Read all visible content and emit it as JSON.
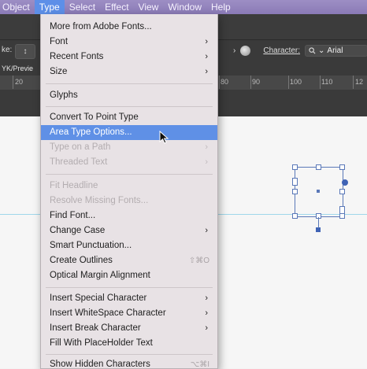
{
  "menubar": {
    "items": [
      "Object",
      "Type",
      "Select",
      "Effect",
      "View",
      "Window",
      "Help"
    ],
    "active": "Type"
  },
  "control_bar": {
    "stroke_label": "ke:",
    "stroke_stepper": "↕",
    "character_label": "Character:",
    "font_search_icon": "search-icon",
    "font_value": "Arial"
  },
  "document_tab": {
    "label": "YK/Previe"
  },
  "ruler": {
    "ticks": [
      "20",
      "80",
      "90",
      "100",
      "110",
      "12"
    ]
  },
  "type_menu": {
    "items": [
      {
        "label": "More from Adobe Fonts...",
        "enabled": true,
        "submenu": false,
        "shortcut": ""
      },
      {
        "label": "Font",
        "enabled": true,
        "submenu": true,
        "shortcut": ""
      },
      {
        "label": "Recent Fonts",
        "enabled": true,
        "submenu": true,
        "shortcut": ""
      },
      {
        "label": "Size",
        "enabled": true,
        "submenu": true,
        "shortcut": ""
      },
      {
        "label": "Glyphs",
        "enabled": true,
        "submenu": false,
        "shortcut": ""
      },
      {
        "label": "Convert To Point Type",
        "enabled": true,
        "submenu": false,
        "shortcut": ""
      },
      {
        "label": "Area Type Options...",
        "enabled": true,
        "submenu": false,
        "shortcut": "",
        "highlighted": true
      },
      {
        "label": "Type on a Path",
        "enabled": false,
        "submenu": true,
        "shortcut": ""
      },
      {
        "label": "Threaded Text",
        "enabled": false,
        "submenu": true,
        "shortcut": ""
      },
      {
        "label": "Fit Headline",
        "enabled": false,
        "submenu": false,
        "shortcut": ""
      },
      {
        "label": "Resolve Missing Fonts...",
        "enabled": false,
        "submenu": false,
        "shortcut": ""
      },
      {
        "label": "Find Font...",
        "enabled": true,
        "submenu": false,
        "shortcut": ""
      },
      {
        "label": "Change Case",
        "enabled": true,
        "submenu": true,
        "shortcut": ""
      },
      {
        "label": "Smart Punctuation...",
        "enabled": true,
        "submenu": false,
        "shortcut": ""
      },
      {
        "label": "Create Outlines",
        "enabled": true,
        "submenu": false,
        "shortcut": "⇧⌘O"
      },
      {
        "label": "Optical Margin Alignment",
        "enabled": true,
        "submenu": false,
        "shortcut": ""
      },
      {
        "label": "Insert Special Character",
        "enabled": true,
        "submenu": true,
        "shortcut": ""
      },
      {
        "label": "Insert WhiteSpace Character",
        "enabled": true,
        "submenu": true,
        "shortcut": ""
      },
      {
        "label": "Insert Break Character",
        "enabled": true,
        "submenu": true,
        "shortcut": ""
      },
      {
        "label": "Fill With PlaceHolder Text",
        "enabled": true,
        "submenu": false,
        "shortcut": ""
      },
      {
        "label": "Show Hidden Characters",
        "enabled": true,
        "submenu": false,
        "shortcut": "⌥⌘I"
      }
    ],
    "arrow_glyph": "›"
  },
  "colors": {
    "menubar": "#8a7ab6",
    "highlight": "#5f90e6",
    "menu_bg": "#e8e2e5",
    "selection": "#3f63b5"
  }
}
